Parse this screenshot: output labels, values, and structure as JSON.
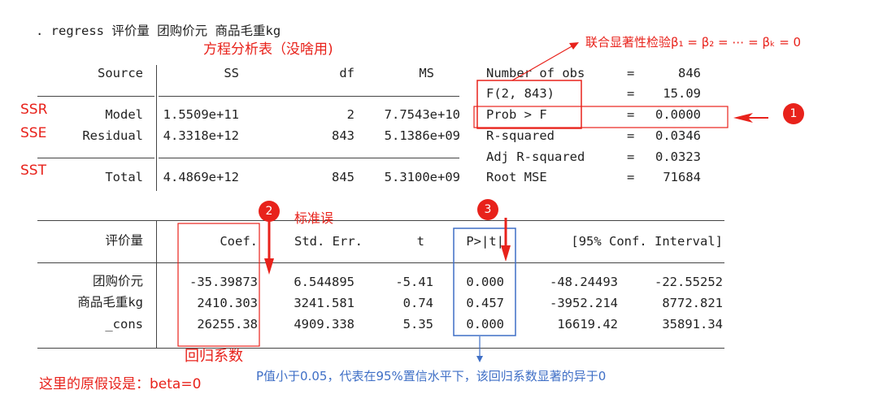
{
  "command": ". regress 评价量 团购价元 商品毛重kg",
  "anova": {
    "headers": {
      "source": "Source",
      "ss": "SS",
      "df": "df",
      "ms": "MS"
    },
    "rows": [
      {
        "source": "Model",
        "ss": "1.5509e+11",
        "df": "2",
        "ms": "7.7543e+10"
      },
      {
        "source": "Residual",
        "ss": "4.3318e+12",
        "df": "843",
        "ms": "5.1386e+09"
      },
      {
        "source": "Total",
        "ss": "4.4869e+12",
        "df": "845",
        "ms": "5.3100e+09"
      }
    ]
  },
  "stats": [
    {
      "label": "Number of obs",
      "eq": "=",
      "value": "846"
    },
    {
      "label": "F(2, 843)",
      "eq": "=",
      "value": "15.09"
    },
    {
      "label": "Prob > F",
      "eq": "=",
      "value": "0.0000"
    },
    {
      "label": "R-squared",
      "eq": "=",
      "value": "0.0346"
    },
    {
      "label": "Adj R-squared",
      "eq": "=",
      "value": "0.0323"
    },
    {
      "label": "Root MSE",
      "eq": "=",
      "value": "71684"
    }
  ],
  "coef_table": {
    "depvar": "评价量",
    "headers": {
      "coef": "Coef.",
      "se": "Std. Err.",
      "t": "t",
      "p": "P>|t|",
      "ci": "[95% Conf. Interval]"
    },
    "rows": [
      {
        "name": "团购价元",
        "coef": "-35.39873",
        "se": "6.544895",
        "t": "-5.41",
        "p": "0.000",
        "lo": "-48.24493",
        "hi": "-22.55252"
      },
      {
        "name": "商品毛重kg",
        "coef": "2410.303",
        "se": "3241.581",
        "t": "0.74",
        "p": "0.457",
        "lo": "-3952.214",
        "hi": "8772.821"
      },
      {
        "name": "_cons",
        "coef": "26255.38",
        "se": "4909.338",
        "t": "5.35",
        "p": "0.000",
        "lo": "16619.42",
        "hi": "35891.34"
      }
    ]
  },
  "annotations": {
    "anova_note": "方程分析表（没啥用)",
    "ssr": "SSR",
    "sse": "SSE",
    "sst": "SST",
    "ftest_note": "联合显著性检验β₁ = β₂ = ⋯ = βₖ = 0",
    "badge1": "1",
    "badge2": "2",
    "badge3": "3",
    "stderr_note": "标准误",
    "coef_note": "回归系数",
    "null_note": "这里的原假设是：beta=0",
    "p_note": "P值小于0.05，代表在95%置信水平下，该回归系数显著的异于0"
  },
  "colors": {
    "red": "#e8221b",
    "blue": "#3f6fc6",
    "text": "#222222"
  }
}
